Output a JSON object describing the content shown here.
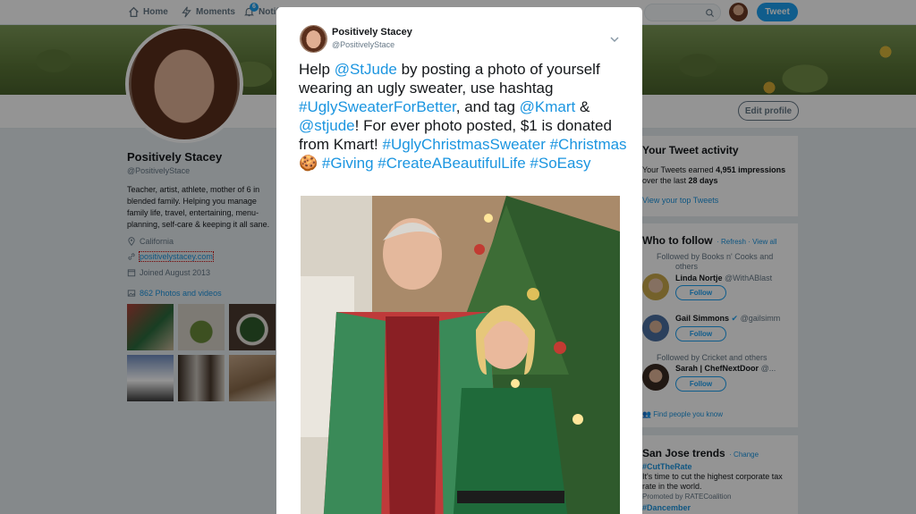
{
  "nav": {
    "home": "Home",
    "moments": "Moments",
    "notifications": "Notifi",
    "notif_count": "6",
    "tweet_button": "Tweet"
  },
  "profile": {
    "name": "Positively Stacey",
    "handle": "@PositivelyStace",
    "bio": "Teacher, artist, athlete, mother of 6 in blended family. Helping you manage family life, travel, entertaining, menu-planning, self-care & keeping it all sane.",
    "location": "California",
    "website": "positivelystacey.com",
    "joined": "Joined August 2013",
    "photos": "862 Photos and videos",
    "edit_profile": "Edit profile"
  },
  "activity": {
    "title": "Your Tweet activity",
    "line1_prefix": "Your Tweets earned ",
    "impressions": "4,951 impressions",
    "line2_prefix": "over the last ",
    "period": "28 days",
    "link": "View your top Tweets"
  },
  "who_to_follow": {
    "title": "Who to follow",
    "refresh": "· Refresh · View all",
    "people": [
      {
        "context": "Followed by Books n' Cooks and",
        "context2": "others",
        "name": "Linda Nortje",
        "handle": "@WithABlast",
        "button": "Follow"
      },
      {
        "context": "",
        "context2": "",
        "name": "Gail Simmons",
        "handle": "@gailsimm",
        "button": "Follow"
      },
      {
        "context": "Followed by Cricket and others",
        "context2": "",
        "name": "Sarah | ChefNextDoor",
        "handle": "@...",
        "button": "Follow"
      }
    ],
    "find_people": "Find people you know"
  },
  "trends": {
    "title": "San Jose trends",
    "change": "· Change",
    "items": [
      {
        "tag": "#CutTheRate",
        "desc": "It's time to cut the highest corporate tax rate in the world.",
        "promoted": "Promoted by RATECoalition"
      },
      {
        "tag": "#Dancember",
        "desc": "",
        "promoted": ""
      }
    ]
  },
  "modal": {
    "name": "Positively Stacey",
    "handle": "@PositivelyStace",
    "text": {
      "t1": "Help ",
      "h1": "@StJude",
      "t2": " by posting a photo of yourself wearing an ugly sweater, use hashtag ",
      "h2": "#UglySweaterForBetter",
      "t3": ", and tag ",
      "h3": "@Kmart",
      "t4": " & ",
      "h4": "@stjude",
      "t5": "! For ever photo posted, $1 is donated from Kmart! ",
      "h5": "#UglyChristmasSweater",
      "t6": " ",
      "h6": "#Christmas",
      "emoji": "🍪",
      "t7": " ",
      "h7": "#Giving",
      "t8": " ",
      "h8": "#CreateABeautifulLife",
      "t9": " ",
      "h9": "#SoEasy"
    }
  }
}
